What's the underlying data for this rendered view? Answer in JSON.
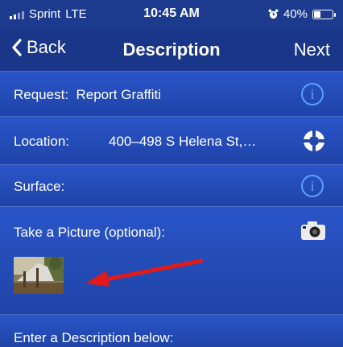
{
  "status": {
    "carrier": "Sprint",
    "network": "LTE",
    "time": "10:45 AM",
    "battery_percent": "40%",
    "battery_level": 0.4
  },
  "nav": {
    "back_label": "Back",
    "title": "Description",
    "next_label": "Next"
  },
  "form": {
    "request": {
      "label": "Request:",
      "value": "Report Graffiti"
    },
    "location": {
      "label": "Location:",
      "value": "400–498 S Helena St,…"
    },
    "surface": {
      "label": "Surface:"
    },
    "picture": {
      "label": "Take a Picture (optional):"
    },
    "description": {
      "label": "Enter a Description below:"
    }
  },
  "icons": {
    "info": "info-icon",
    "target": "crosshair-target-icon",
    "camera": "camera-icon",
    "arrow": "red-arrow-annotation"
  },
  "colors": {
    "accent": "#5aa0ff",
    "arrow": "#e11b1b"
  }
}
